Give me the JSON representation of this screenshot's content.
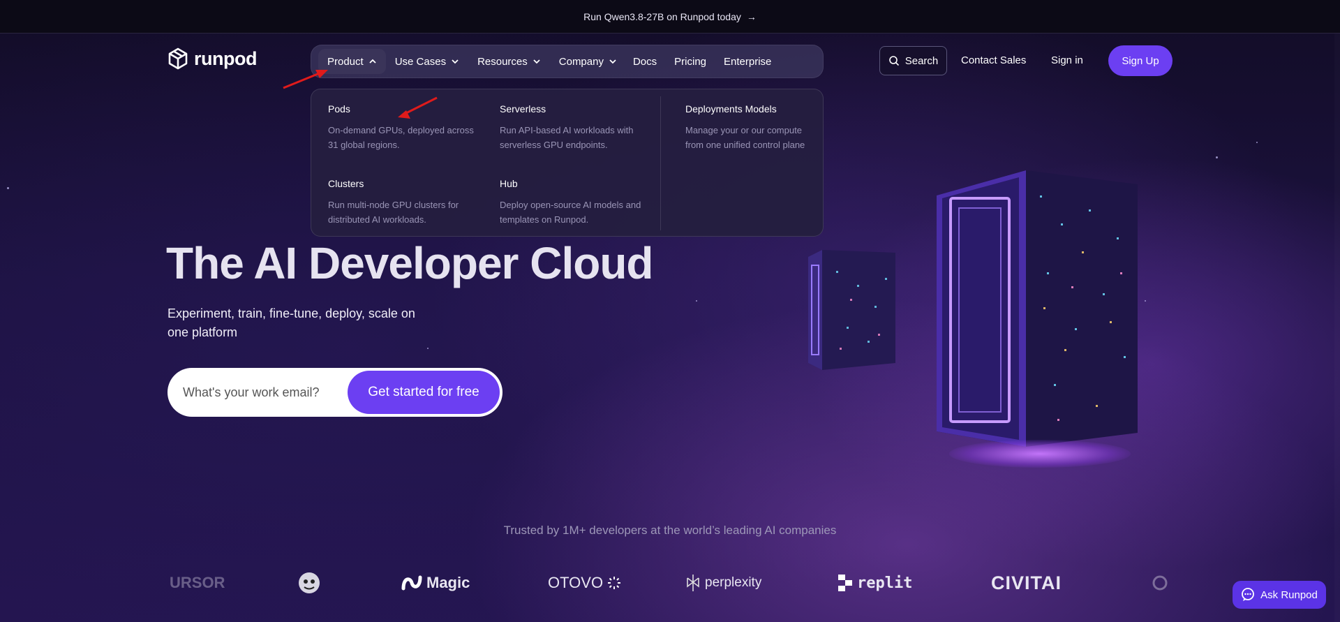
{
  "announcement": {
    "text": "Run Qwen3.8-27B on Runpod today",
    "arrow": "→"
  },
  "brand": {
    "name": "runpod"
  },
  "nav": {
    "items": [
      {
        "label": "Product",
        "has_dropdown": true,
        "open": true
      },
      {
        "label": "Use Cases",
        "has_dropdown": true
      },
      {
        "label": "Resources",
        "has_dropdown": true
      },
      {
        "label": "Company",
        "has_dropdown": true
      },
      {
        "label": "Docs"
      },
      {
        "label": "Pricing"
      },
      {
        "label": "Enterprise"
      }
    ]
  },
  "header_actions": {
    "search_label": "Search",
    "contact_label": "Contact Sales",
    "signin_label": "Sign in",
    "signup_label": "Sign Up"
  },
  "product_menu": [
    {
      "title": "Pods",
      "description": "On-demand GPUs, deployed across 31 global regions."
    },
    {
      "title": "Serverless",
      "description": "Run API-based AI workloads with serverless GPU endpoints."
    },
    {
      "title": "Deployments Models",
      "description": "Manage your or our compute from one unified control plane"
    },
    {
      "title": "Clusters",
      "description": "Run multi-node GPU clusters for distributed AI workloads."
    },
    {
      "title": "Hub",
      "description": "Deploy open-source AI models and templates on Runpod."
    }
  ],
  "hero": {
    "title": "The AI Developer Cloud",
    "subtitle": "Experiment, train, fine-tune, deploy, scale on one platform",
    "email_placeholder": "What's your work email?",
    "cta_label": "Get started for free"
  },
  "trusted": {
    "text": "Trusted by 1M+ developers at the world’s leading AI companies"
  },
  "logos": {
    "cursor": "URSOR",
    "magic": "Magic",
    "otovo": "OTOVO",
    "perplexity": "perplexity",
    "replit": "replit",
    "civitai": "CIVITAI"
  },
  "ask": {
    "label": "Ask Runpod"
  },
  "colors": {
    "accent": "#6c3ff2",
    "annotation": "#e01b1b",
    "background": "#1c1240"
  }
}
